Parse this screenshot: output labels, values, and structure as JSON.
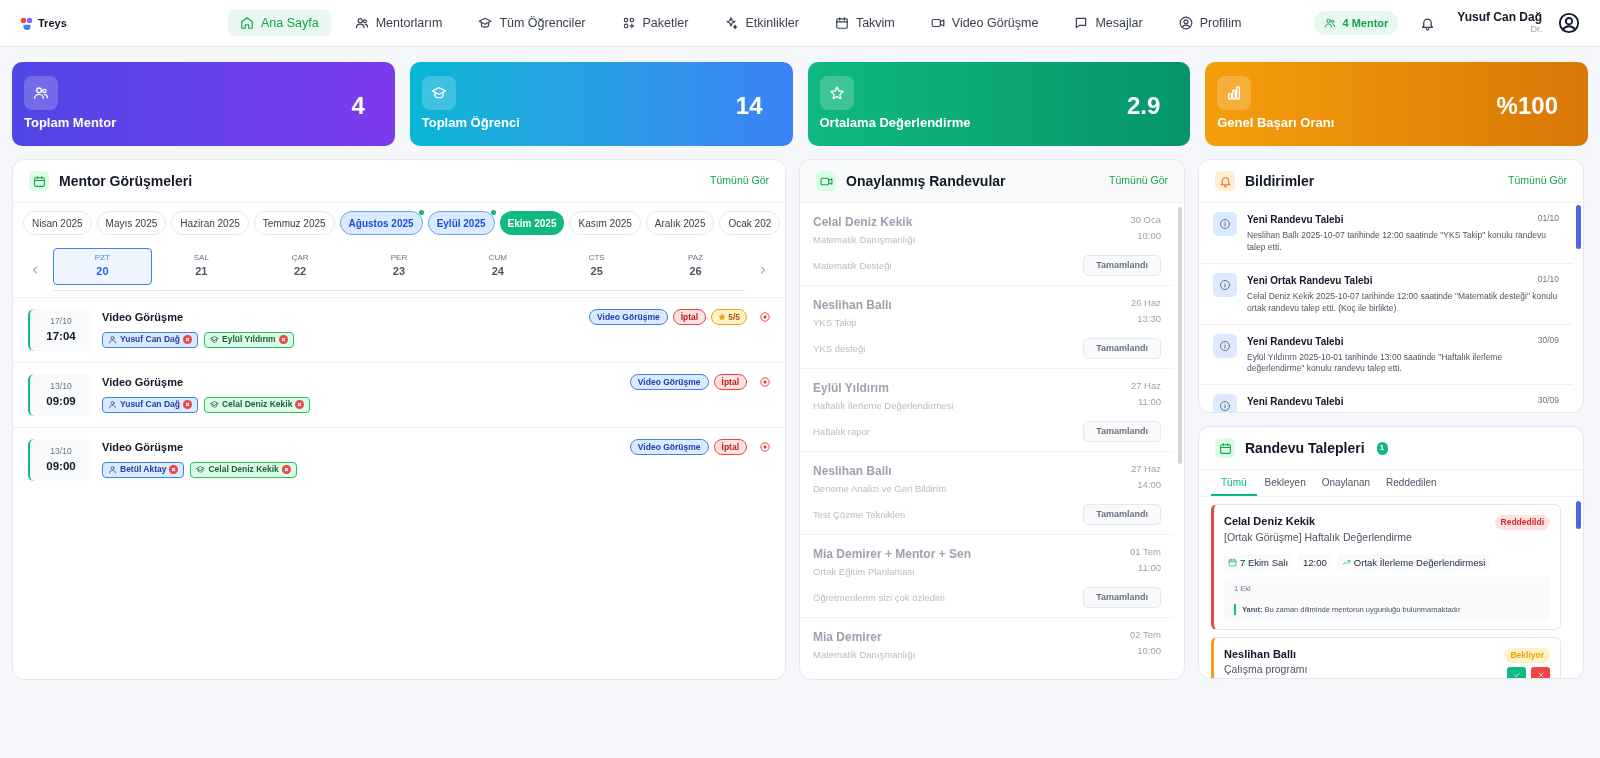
{
  "brand": {
    "name": "Treys"
  },
  "nav": [
    {
      "label": "Ana Sayfa",
      "selected": true
    },
    {
      "label": "Mentorlarım",
      "selected": false
    },
    {
      "label": "Tüm Öğrenciler",
      "selected": false
    },
    {
      "label": "Paketler",
      "selected": false
    },
    {
      "label": "Etkinlikler",
      "selected": false
    },
    {
      "label": "Takvim",
      "selected": false
    },
    {
      "label": "Video Görüşme",
      "selected": false
    },
    {
      "label": "Mesajlar",
      "selected": false
    },
    {
      "label": "Profilim",
      "selected": false
    }
  ],
  "mentor_badge": "4 Mentor",
  "user": {
    "name": "Yusuf Can Dağ",
    "title": "Dr."
  },
  "stats": [
    {
      "kind": "mentor",
      "label": "Toplam Mentor",
      "value": "4"
    },
    {
      "kind": "student",
      "label": "Toplam Öğrenci",
      "value": "14"
    },
    {
      "kind": "rating",
      "label": "Ortalama Değerlendirme",
      "value": "2.9"
    },
    {
      "kind": "success",
      "label": "Genel Başarı Oranı",
      "value": "%100"
    }
  ],
  "mentor_meetings": {
    "title": "Mentor Görüşmeleri",
    "see_all": "Tümünü Gör",
    "months": [
      {
        "label": "Nisan 2025",
        "selected": false,
        "has_sessions": false
      },
      {
        "label": "Mayıs 2025",
        "selected": false,
        "has_sessions": false
      },
      {
        "label": "Haziran 2025",
        "selected": false,
        "has_sessions": false
      },
      {
        "label": "Temmuz 2025",
        "selected": false,
        "has_sessions": false
      },
      {
        "label": "Ağustos 2025",
        "selected": false,
        "has_sessions": true
      },
      {
        "label": "Eylül 2025",
        "selected": false,
        "has_sessions": true
      },
      {
        "label": "Ekim 2025",
        "selected": true,
        "has_sessions": false
      },
      {
        "label": "Kasım 2025",
        "selected": false,
        "has_sessions": false
      },
      {
        "label": "Aralık 2025",
        "selected": false,
        "has_sessions": false
      },
      {
        "label": "Ocak 202",
        "selected": false,
        "has_sessions": false
      }
    ],
    "days": [
      {
        "weekday": "PZT",
        "day": "20",
        "selected": true
      },
      {
        "weekday": "SAL",
        "day": "21",
        "selected": false
      },
      {
        "weekday": "ÇAR",
        "day": "22",
        "selected": false
      },
      {
        "weekday": "PER",
        "day": "23",
        "selected": false
      },
      {
        "weekday": "CUM",
        "day": "24",
        "selected": false
      },
      {
        "weekday": "CTS",
        "day": "25",
        "selected": false
      },
      {
        "weekday": "PAZ",
        "day": "26",
        "selected": false
      }
    ],
    "meetings": [
      {
        "date": "17/10",
        "time": "17:04",
        "title": "Video Görüşme",
        "tags": [
          {
            "kind": "type",
            "label": "Video Görüşme"
          },
          {
            "kind": "status",
            "label": "İptal"
          },
          {
            "kind": "rating",
            "label": "5/5"
          }
        ],
        "people": [
          {
            "kind": "mentor",
            "name": "Yusuf Can Dağ"
          },
          {
            "kind": "student",
            "name": "Eylül Yıldırım"
          }
        ]
      },
      {
        "date": "13/10",
        "time": "09:09",
        "title": "Video Görüşme",
        "tags": [
          {
            "kind": "type",
            "label": "Video Görüşme"
          },
          {
            "kind": "status",
            "label": "İptal"
          }
        ],
        "people": [
          {
            "kind": "mentor",
            "name": "Yusuf Can Dağ"
          },
          {
            "kind": "student",
            "name": "Celal Deniz Kekik"
          }
        ]
      },
      {
        "date": "13/10",
        "time": "09:00",
        "title": "Video Görüşme",
        "tags": [
          {
            "kind": "type",
            "label": "Video Görüşme"
          },
          {
            "kind": "status",
            "label": "İptal"
          }
        ],
        "people": [
          {
            "kind": "mentor",
            "name": "Betül Aktay"
          },
          {
            "kind": "student",
            "name": "Celal Deniz Kekik"
          }
        ]
      }
    ]
  },
  "approved": {
    "title": "Onaylanmış Randevular",
    "see_all": "Tümünü Gör",
    "items": [
      {
        "name": "Celal Deniz Kekik",
        "subject": "Matematik Danışmanlığı",
        "date": "30 Oca",
        "time": "10:00",
        "note": "Matematik Desteği",
        "status": "Tamamlandı"
      },
      {
        "name": "Neslihan Ballı",
        "subject": "YKS Takip",
        "date": "26 Haz",
        "time": "13:30",
        "note": "YKS desteği",
        "status": "Tamamlandı"
      },
      {
        "name": "Eylül Yıldırım",
        "subject": "Haftalık İlerleme Değerlendirmesi",
        "date": "27 Haz",
        "time": "11:00",
        "note": "Haftalık rapor",
        "status": "Tamamlandı"
      },
      {
        "name": "Neslihan Ballı",
        "subject": "Deneme Analizi ve Geri Bildirim",
        "date": "27 Haz",
        "time": "14:00",
        "note": "Test Çözme Teknikleri",
        "status": "Tamamlandı"
      },
      {
        "name": "Mia Demirer + Mentor + Sen",
        "subject": "Ortak Eğitim Planlaması",
        "date": "01 Tem",
        "time": "11:00",
        "note": "Öğretmenlerim sizi çok özledim",
        "status": "Tamamlandı"
      },
      {
        "name": "Mia Demirer",
        "subject": "Matematik Danışmanlığı",
        "date": "02 Tem",
        "time": "10:00"
      }
    ]
  },
  "notifications": {
    "title": "Bildirimler",
    "see_all": "Tümünü Gör",
    "items": [
      {
        "title": "Yeni Randevu Talebi",
        "date": "01/10",
        "text": "Neslihan Ballı 2025-10-07 tarihinde 12:00 saatinde \"YKS Takip\" konulu randevu talep etti."
      },
      {
        "title": "Yeni Ortak Randevu Talebi",
        "date": "01/10",
        "text": "Celal Deniz Kekik 2025-10-07 tarihinde 12:00 saatinde \"Matematik desteği\" konulu ortak randevu talep etti. (Koç ile birlikte)"
      },
      {
        "title": "Yeni Randevu Talebi",
        "date": "30/09",
        "text": "Eylül Yıldırım 2025-10-01 tarihinde 13:00 saatinde \"Haftalık ilerleme değerlendirme\" konulu randevu talep etti."
      },
      {
        "title": "Yeni Randevu Talebi",
        "date": "30/09"
      }
    ]
  },
  "requests": {
    "title": "Randevu Talepleri",
    "count": "1",
    "tabs": [
      {
        "label": "Tümü",
        "selected": true
      },
      {
        "label": "Bekleyen",
        "selected": false
      },
      {
        "label": "Onaylanan",
        "selected": false
      },
      {
        "label": "Reddedilen",
        "selected": false
      }
    ],
    "items": [
      {
        "kind": "rejected",
        "name": "Celal Deniz Kekik",
        "subject": "[Ortak Görüşme] Haftalık Değerlendirme",
        "status": "Reddedildi",
        "date": "7 Ekim Salı",
        "time": "12:00",
        "topic": "Ortak İlerleme Değerlendirmesi",
        "note": "1 Eki",
        "reply": "**Yanıt:** Bu zaman diliminde mentorun uygunluğu bulunmamaktadır"
      },
      {
        "kind": "pending",
        "name": "Neslihan Ballı",
        "subject": "Çalışma programı",
        "status": "Bekliyor"
      }
    ]
  }
}
